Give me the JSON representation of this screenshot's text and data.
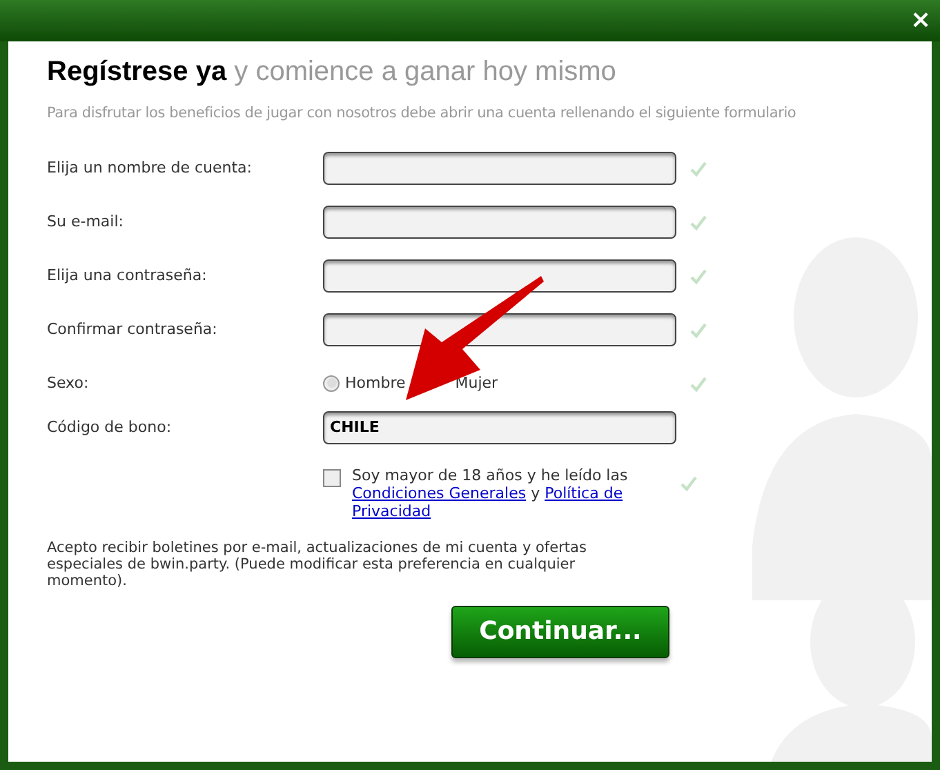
{
  "close_button": "×",
  "heading": {
    "main": "Regístrese ya",
    "rest": "y comience a ganar hoy mismo"
  },
  "intro": "Para disfrutar los beneficios de jugar con nosotros debe abrir una cuenta rellenando el siguiente formulario",
  "fields": [
    {
      "kind": "text",
      "label": "Elija un nombre de cuenta:"
    },
    {
      "kind": "text",
      "label": "Su e-mail:"
    },
    {
      "kind": "text",
      "label": "Elija una contraseña:"
    },
    {
      "kind": "text",
      "label": "Confirmar contraseña:"
    },
    {
      "kind": "radio",
      "label": "Sexo:",
      "options": [
        {
          "label": "Hombre",
          "selected": false
        },
        {
          "label": "Mujer"
        }
      ]
    },
    {
      "kind": "code",
      "label": "Código de bono:",
      "value": "CHILE"
    }
  ],
  "agreement": {
    "checked": false,
    "text": "Soy mayor de 18 años y he leído las",
    "link1": "Condiciones Generales",
    "joiner": "y",
    "link2": "Política de Privacidad"
  },
  "newsletter": "Acepto recibir boletines por e-mail, actualizaciones de mi cuenta y ofertas especiales de bwin.party. (Puede modificar esta preferencia en cualquier momento).",
  "continue_button": "Continuar..."
}
